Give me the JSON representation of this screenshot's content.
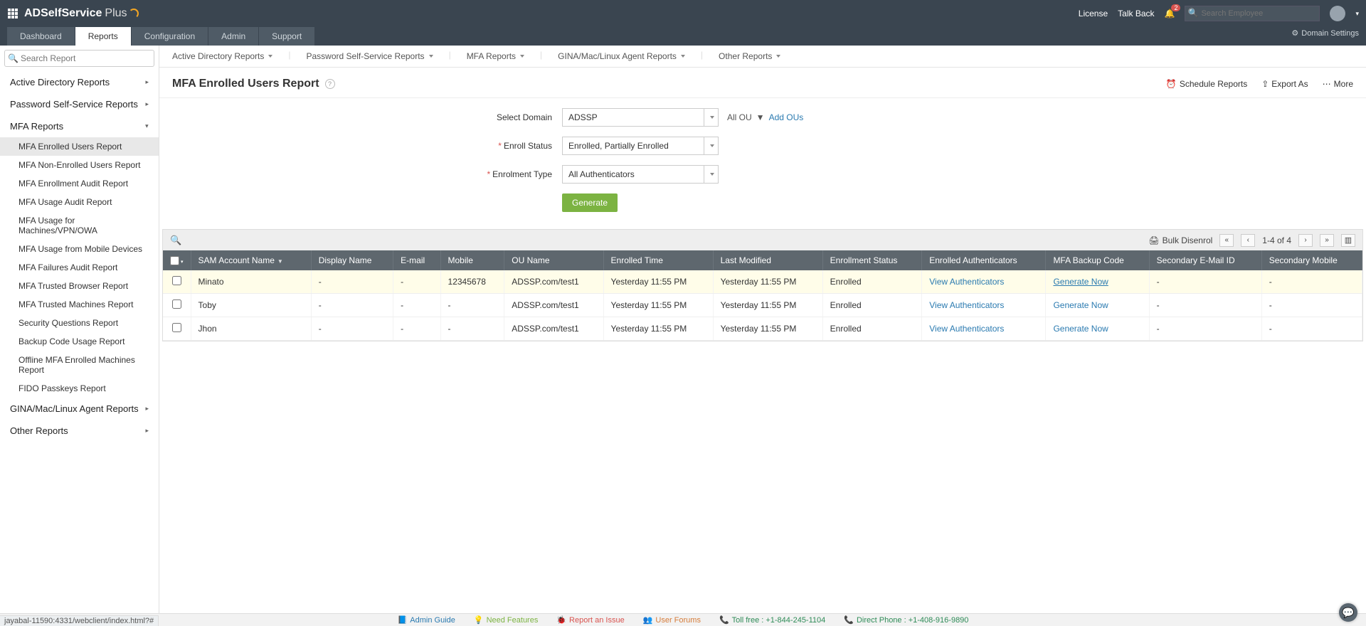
{
  "brand": {
    "name": "ADSelfService",
    "suffix": "Plus"
  },
  "topbar": {
    "license": "License",
    "talkback": "Talk Back",
    "notif_count": "2",
    "search_placeholder": "Search Employee"
  },
  "tabs": {
    "items": [
      "Dashboard",
      "Reports",
      "Configuration",
      "Admin",
      "Support"
    ],
    "active_index": 1,
    "domain_settings": "Domain Settings"
  },
  "secnav": {
    "items": [
      "Active Directory Reports",
      "Password Self-Service Reports",
      "MFA Reports",
      "GINA/Mac/Linux Agent Reports",
      "Other Reports"
    ]
  },
  "sidebar": {
    "search_placeholder": "Search Report",
    "cats": [
      {
        "label": "Active Directory Reports",
        "open": false
      },
      {
        "label": "Password Self-Service Reports",
        "open": false
      },
      {
        "label": "MFA Reports",
        "open": true,
        "subs": [
          "MFA Enrolled Users Report",
          "MFA Non-Enrolled Users Report",
          "MFA Enrollment Audit Report",
          "MFA Usage Audit Report",
          "MFA Usage for Machines/VPN/OWA",
          "MFA Usage from Mobile Devices",
          "MFA Failures Audit Report",
          "MFA Trusted Browser Report",
          "MFA Trusted Machines Report",
          "Security Questions Report",
          "Backup Code Usage Report",
          "Offline MFA Enrolled Machines Report",
          "FIDO Passkeys Report"
        ],
        "active_sub": 0
      },
      {
        "label": "GINA/Mac/Linux Agent Reports",
        "open": false
      },
      {
        "label": "Other Reports",
        "open": false
      }
    ]
  },
  "page": {
    "title": "MFA Enrolled Users Report",
    "actions": {
      "schedule": "Schedule Reports",
      "export": "Export As",
      "more": "More"
    }
  },
  "filters": {
    "domain_label": "Select Domain",
    "domain_value": "ADSSP",
    "all_ou": "All OU",
    "add_ous": "Add OUs",
    "enroll_status_label": "Enroll Status",
    "enroll_status_value": "Enrolled, Partially Enrolled",
    "enrol_type_label": "Enrolment Type",
    "enrol_type_value": "All Authenticators",
    "generate": "Generate"
  },
  "toolbar": {
    "bulk": "Bulk Disenrol",
    "pager": "1-4 of 4"
  },
  "table": {
    "headers": [
      "SAM Account Name",
      "Display Name",
      "E-mail",
      "Mobile",
      "OU Name",
      "Enrolled Time",
      "Last Modified",
      "Enrollment Status",
      "Enrolled Authenticators",
      "MFA Backup Code",
      "Secondary E-Mail ID",
      "Secondary Mobile"
    ],
    "sort_col": 0,
    "link_view": "View Authenticators",
    "link_gen": "Generate Now",
    "rows": [
      {
        "hl": true,
        "cells": [
          "Minato",
          "-",
          "-",
          "12345678",
          "ADSSP.com/test1",
          "Yesterday 11:55 PM",
          "Yesterday 11:55 PM",
          "Enrolled",
          "__VIEW__",
          "__GEN_U__",
          "-",
          "-"
        ]
      },
      {
        "hl": false,
        "cells": [
          "Toby",
          "-",
          "-",
          "-",
          "ADSSP.com/test1",
          "Yesterday 11:55 PM",
          "Yesterday 11:55 PM",
          "Enrolled",
          "__VIEW__",
          "__GEN__",
          "-",
          "-"
        ]
      },
      {
        "hl": false,
        "cells": [
          "Jhon",
          "-",
          "-",
          "-",
          "ADSSP.com/test1",
          "Yesterday 11:55 PM",
          "Yesterday 11:55 PM",
          "Enrolled",
          "__VIEW__",
          "__GEN__",
          "-",
          "-"
        ]
      }
    ]
  },
  "footer": {
    "admin_guide": "Admin Guide",
    "need_features": "Need Features",
    "report_issue": "Report an Issue",
    "user_forums": "User Forums",
    "toll_free": "Toll free : +1-844-245-1104",
    "direct": "Direct Phone : +1-408-916-9890"
  },
  "status_url": "jayabal-11590:4331/webclient/index.html?#"
}
